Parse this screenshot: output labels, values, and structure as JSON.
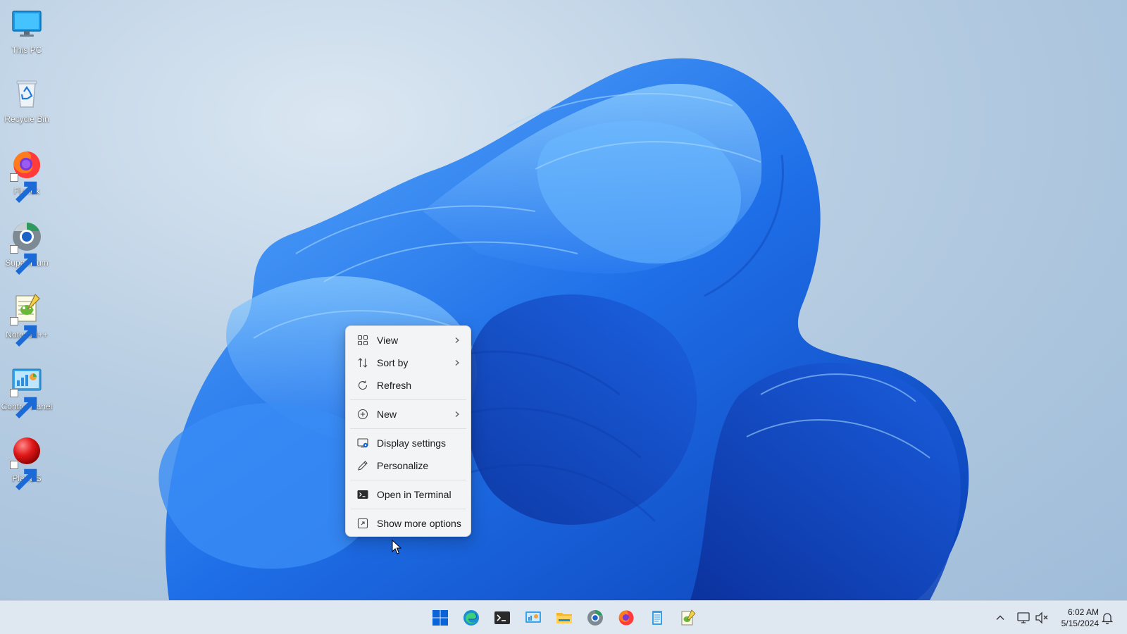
{
  "desktop": {
    "icons": [
      {
        "label": "This PC",
        "icon": "monitor-icon"
      },
      {
        "label": "Recycle Bin",
        "icon": "recycle-bin-icon"
      },
      {
        "label": "Firefox",
        "icon": "firefox-icon"
      },
      {
        "label": "Supermium",
        "icon": "supermium-icon"
      },
      {
        "label": "Notepad++",
        "icon": "notepad-plus-plus-icon"
      },
      {
        "label": "Control Panel",
        "icon": "control-panel-icon"
      },
      {
        "label": "PlatfOS",
        "icon": "platfos-icon"
      }
    ]
  },
  "context_menu": {
    "items": [
      {
        "label": "View",
        "icon": "view-grid-icon",
        "submenu": true
      },
      {
        "label": "Sort by",
        "icon": "sort-icon",
        "submenu": true
      },
      {
        "label": "Refresh",
        "icon": "refresh-icon",
        "submenu": false
      },
      {
        "label": "New",
        "icon": "new-plus-icon",
        "submenu": true
      },
      {
        "label": "Display settings",
        "icon": "display-settings-icon",
        "submenu": false
      },
      {
        "label": "Personalize",
        "icon": "personalize-pen-icon",
        "submenu": false
      },
      {
        "label": "Open in Terminal",
        "icon": "terminal-icon",
        "submenu": false
      },
      {
        "label": "Show more options",
        "icon": "show-more-options-icon",
        "submenu": false
      }
    ]
  },
  "taskbar": {
    "apps": [
      "start-icon",
      "edge-icon",
      "terminal-icon",
      "control-panel-icon",
      "file-explorer-icon",
      "supermium-icon",
      "firefox-icon",
      "notepad-icon",
      "notepad-plus-plus-icon"
    ],
    "tray": {
      "time": "6:02 AM",
      "date": "5/15/2024"
    }
  },
  "colors": {
    "accent": "#0a64d8",
    "taskbar_bg": "#dfe7f1",
    "menu_bg": "#f3f4f6"
  }
}
